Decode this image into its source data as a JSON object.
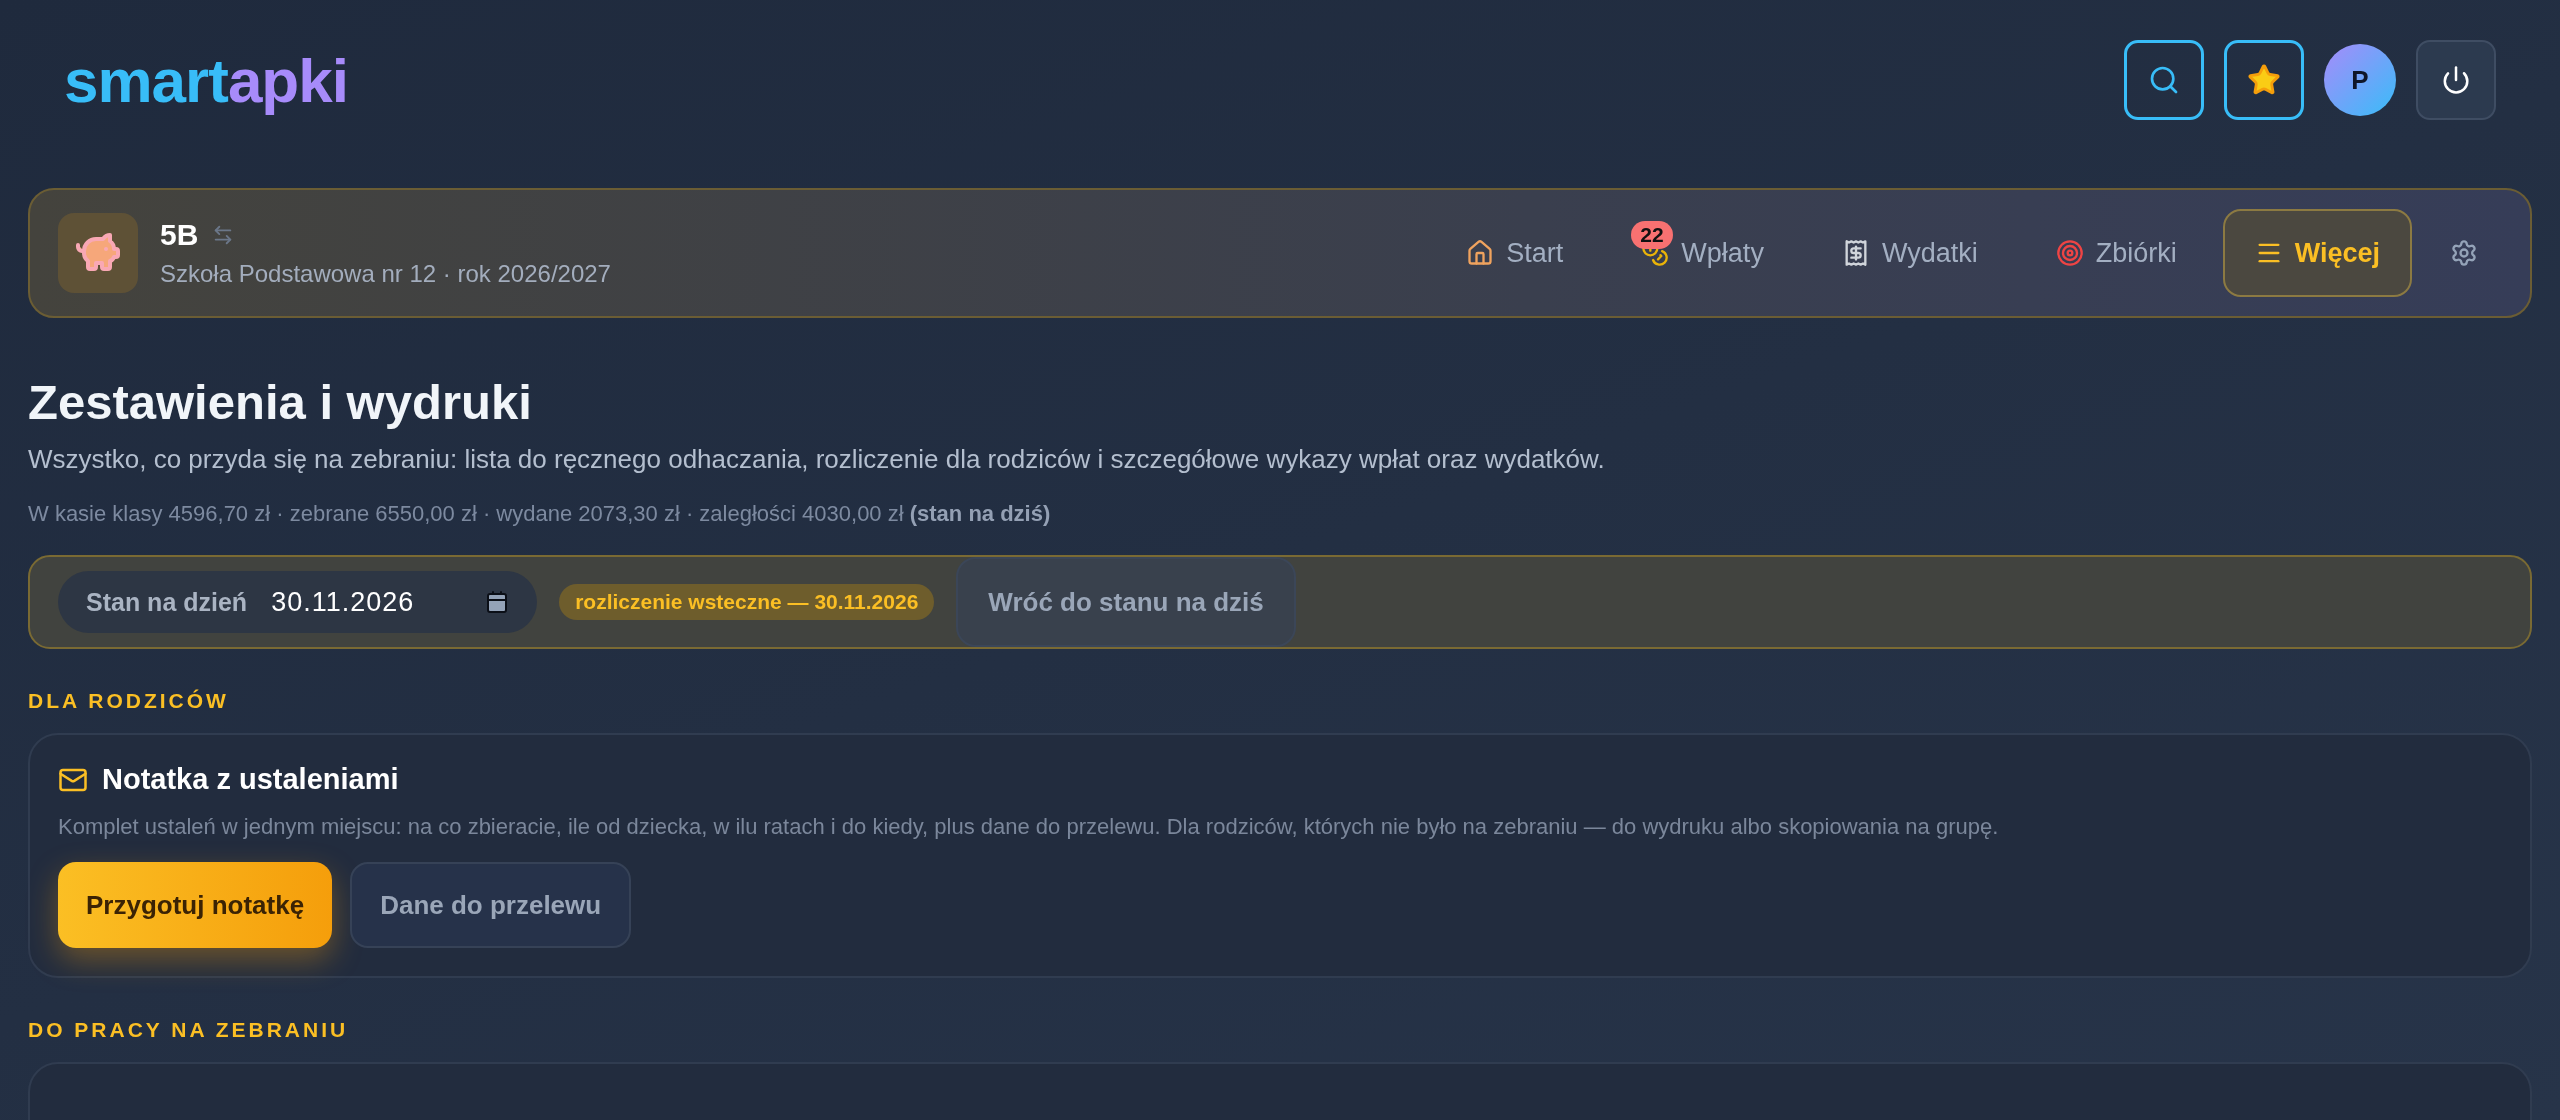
{
  "logo": {
    "part_1": "smart",
    "part_2": "apki"
  },
  "header_actions": [
    {
      "kind": "search"
    },
    {
      "kind": "star"
    },
    {
      "kind": "avatar",
      "label": "P"
    },
    {
      "kind": "power"
    }
  ],
  "class_bar": {
    "name": "5B",
    "subtitle": "Szkoła Podstawowa nr 12 · rok 2026/2027",
    "nav": [
      {
        "label": "Start",
        "selected": false
      },
      {
        "label": "Wpłaty",
        "selected": false,
        "badge": "22"
      },
      {
        "label": "Wydatki",
        "selected": false
      },
      {
        "label": "Zbiórki",
        "selected": false
      },
      {
        "label": "Więcej",
        "selected": true
      }
    ]
  },
  "page": {
    "title": "Zestawienia i wydruki",
    "subtitle": "Wszystko, co przyda się na zebraniu: lista do ręcznego odhaczania, rozliczenie dla rodziców i szczegółowe wykazy wpłat oraz wydatków.",
    "stats": "W kasie klasy 4596,70 zł · zebrane 6550,00 zł · wydane 2073,30 zł · zaległości 4030,00 zł **(stan na dziś)**"
  },
  "date_bar": {
    "label": "Stan na dzień",
    "value": "30.11.2026",
    "badge": "rozliczenie wsteczne — 30.11.2026",
    "reset_button": "Wróć do stanu na dziś"
  },
  "sections": [
    {
      "heading": "DLA RODZICÓW",
      "cards": [
        {
          "title": "Notatka z ustaleniami",
          "description": "Komplet ustaleń w jednym miejscu: na co zbieracie, ile od dziecka, w ilu ratach i do kiedy, plus dane do przelewu. Dla rodziców, których nie było na zebraniu — do wydruku albo skopiowania na grupę.",
          "buttons": [
            {
              "label": "Przygotuj notatkę",
              "kind": "primary"
            },
            {
              "label": "Dane do przelewu",
              "kind": "secondary"
            }
          ]
        }
      ]
    },
    {
      "heading": "DO PRACY NA ZEBRANIU"
    }
  ]
}
